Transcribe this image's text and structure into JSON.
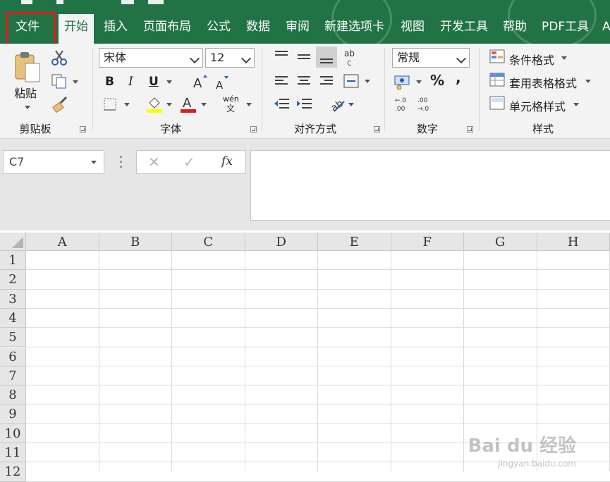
{
  "ribbon_tabs": [
    {
      "label": "文件"
    },
    {
      "label": "开始"
    },
    {
      "label": "插入"
    },
    {
      "label": "页面布局"
    },
    {
      "label": "公式"
    },
    {
      "label": "数据"
    },
    {
      "label": "审阅"
    },
    {
      "label": "新建选项卡"
    },
    {
      "label": "视图"
    },
    {
      "label": "开发工具"
    },
    {
      "label": "帮助"
    },
    {
      "label": "PDF工具"
    },
    {
      "label": "A"
    }
  ],
  "active_tab": "开始",
  "highlighted_tab": "文件",
  "colors": {
    "accent": "#217346",
    "highlight": "#e01b1b",
    "fill_color_bar": "#ffff00",
    "font_color_bar": "#e01b1b"
  },
  "clipboard": {
    "paste_label": "粘贴",
    "group_label": "剪贴板"
  },
  "font": {
    "name": "宋体",
    "size": "12",
    "bold": "B",
    "italic": "I",
    "underline": "U",
    "group_label": "字体",
    "phonetic": "wén"
  },
  "alignment": {
    "group_label": "对齐方式"
  },
  "number": {
    "format": "常规",
    "percent": "%",
    "comma": ",",
    "group_label": "数字"
  },
  "styles": {
    "conditional": "条件格式",
    "table_format": "套用表格格式",
    "cell_styles": "单元格样式",
    "group_label": "样式"
  },
  "formula_bar": {
    "name_box": "C7",
    "cancel": "✕",
    "enter": "✓",
    "fx": "fx"
  },
  "columns": [
    "A",
    "B",
    "C",
    "D",
    "E",
    "F",
    "G",
    "H"
  ],
  "rows": [
    "1",
    "2",
    "3",
    "4",
    "5",
    "6",
    "7",
    "8",
    "9",
    "10",
    "11",
    "12"
  ],
  "watermark": {
    "brand": "Bai du 经验",
    "url": "jingyan.baidu.com"
  }
}
